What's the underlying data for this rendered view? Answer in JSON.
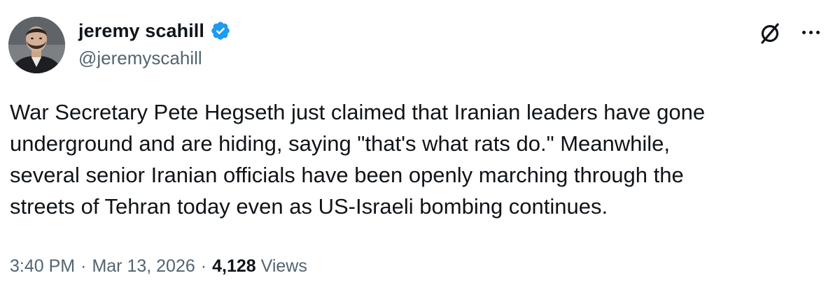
{
  "author": {
    "display_name": "jeremy scahill",
    "handle": "@jeremyscahill",
    "verified": true
  },
  "tweet": {
    "text": "War Secretary Pete Hegseth just claimed that Iranian leaders have gone\nunderground and are hiding, saying \"that's what rats do.\" Meanwhile,\nseveral senior Iranian officials have been openly marching through the\nstreets of Tehran today even as US-Israeli bombing continues.",
    "time": "3:40 PM",
    "date": "Mar 13, 2026",
    "separator": "·",
    "views_count": "4,128",
    "views_label": "Views"
  },
  "icons": {
    "grok": "grok-icon",
    "more": "more-options-icon",
    "verified": "verified-badge-icon"
  },
  "colors": {
    "text_primary": "#0f1419",
    "text_secondary": "#536471",
    "verified_blue": "#1d9bf0",
    "background": "#ffffff"
  }
}
